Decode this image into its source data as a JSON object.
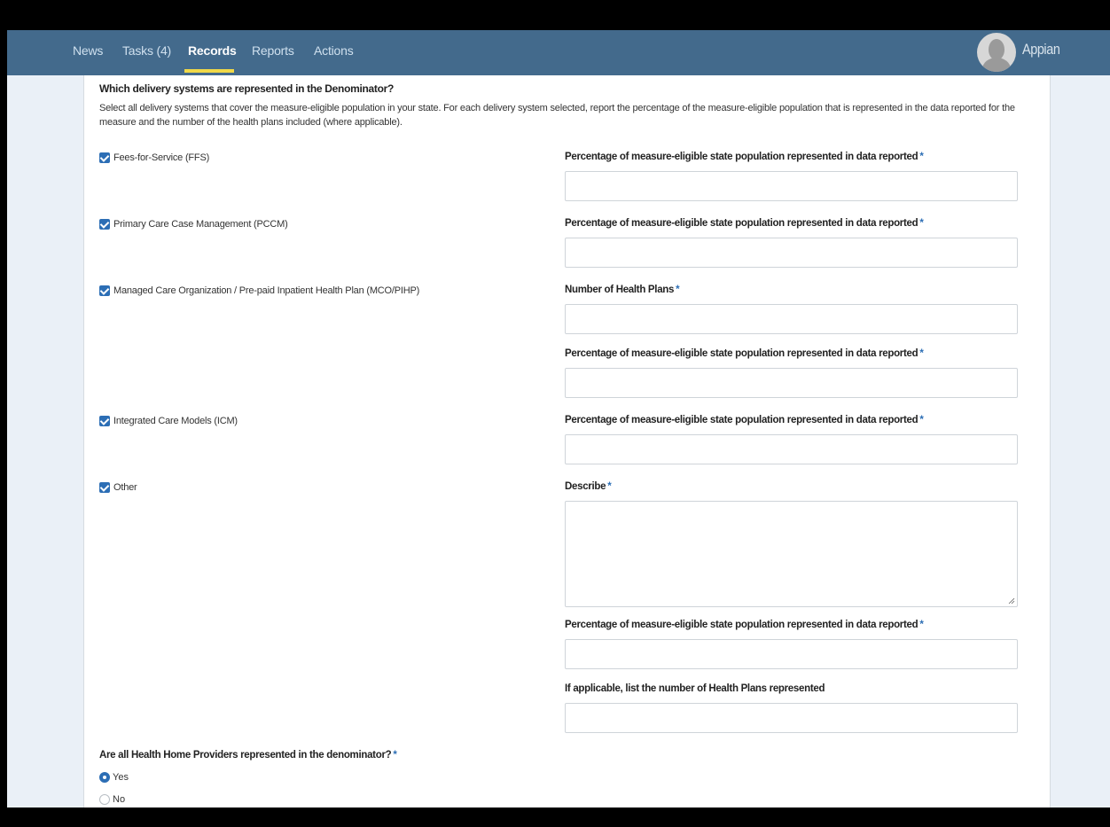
{
  "nav": {
    "tabs": [
      {
        "label": "News"
      },
      {
        "label": "Tasks (4)"
      },
      {
        "label": "Records"
      },
      {
        "label": "Reports"
      },
      {
        "label": "Actions"
      }
    ],
    "active_tab": "Records",
    "brand": "Appian",
    "accent_color": "#f0d848",
    "bar_color": "#436a8c"
  },
  "form": {
    "question": "Which delivery systems are represented in the Denominator?",
    "instructions": "Select all delivery systems that cover the measure-eligible population in your state. For each delivery system selected, report the percentage of the measure-eligible population that is represented in the data reported for the measure and the number of the health plans included (where applicable).",
    "delivery_systems": [
      {
        "label": "Fees-for-Service (FFS)",
        "checked": true
      },
      {
        "label": "Primary Care Case Management (PCCM)",
        "checked": true
      },
      {
        "label": "Managed Care Organization / Pre-paid Inpatient Health Plan (MCO/PIHP)",
        "checked": true
      },
      {
        "label": "Integrated Care Models (ICM)",
        "checked": true
      },
      {
        "label": "Other",
        "checked": true
      }
    ],
    "fields": {
      "pct_label": "Percentage of measure-eligible state population represented in data reported",
      "num_plans_label": "Number of Health Plans",
      "describe_label": "Describe",
      "applicable_plans_label": "If applicable, list the number of Health Plans represented",
      "required_marker": "*"
    },
    "providers_question": "Are all Health Home Providers represented in the denominator?",
    "providers_options": [
      {
        "label": "Yes",
        "selected": true
      },
      {
        "label": "No",
        "selected": false
      }
    ]
  }
}
